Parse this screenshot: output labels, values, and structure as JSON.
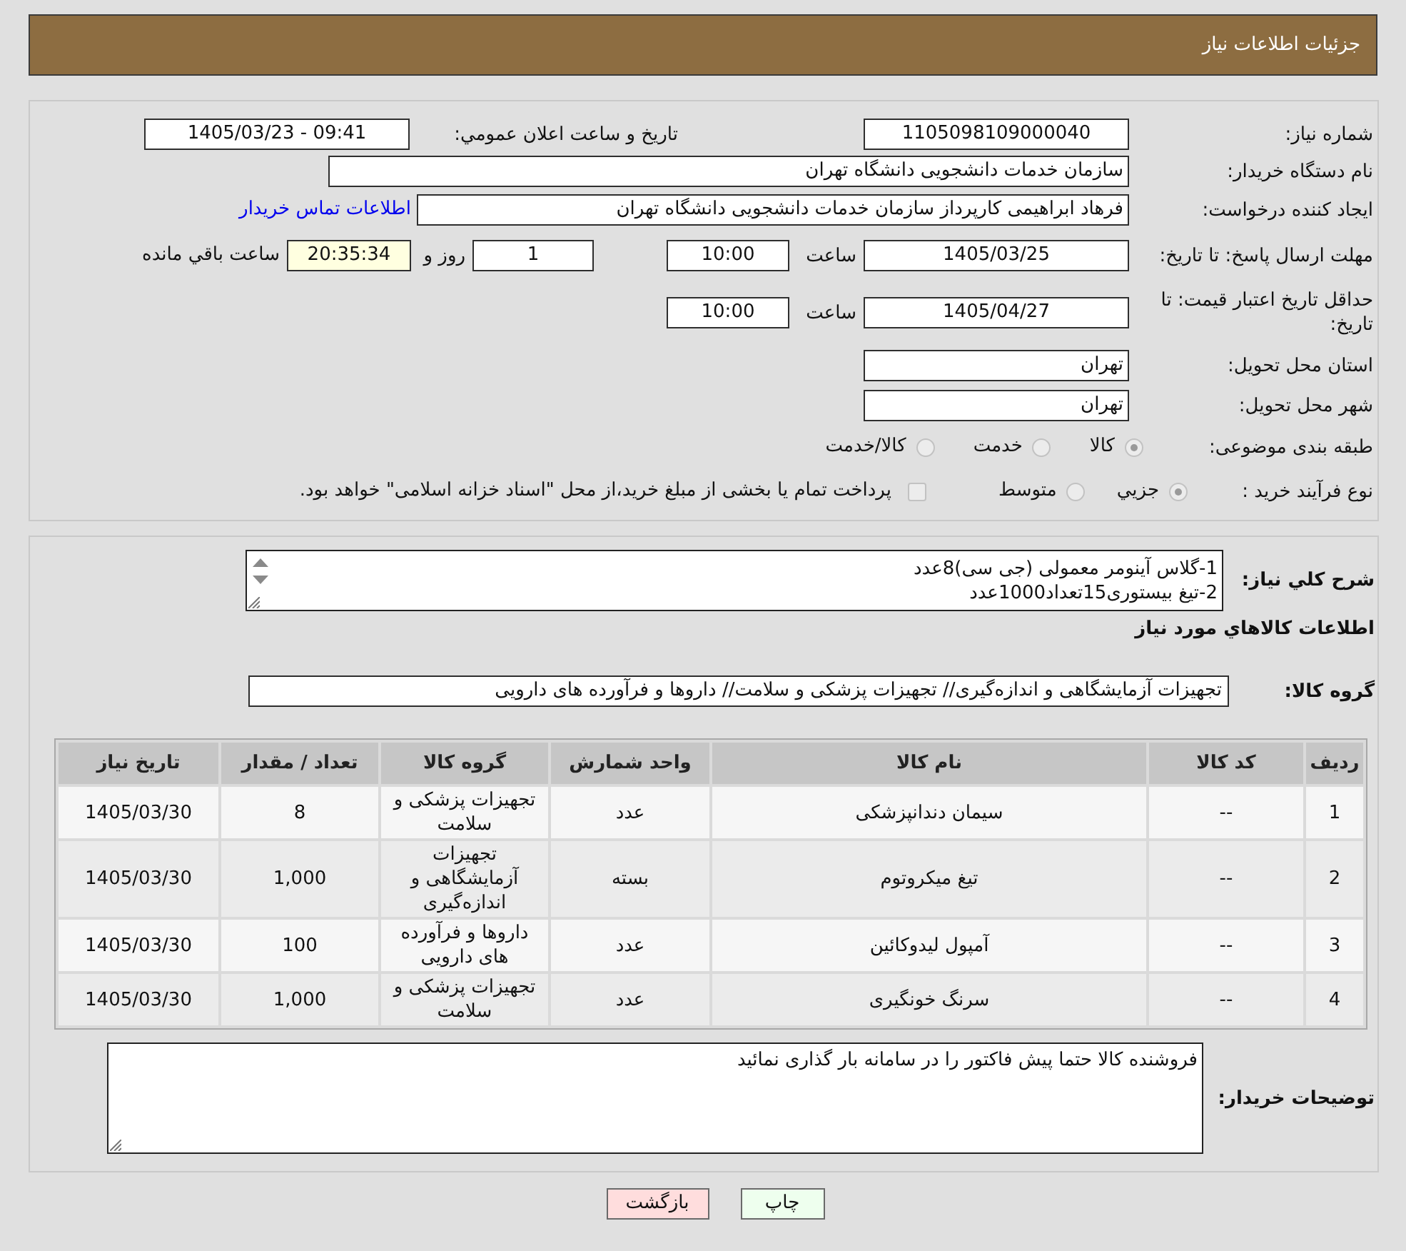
{
  "header": {
    "title": "جزئیات اطلاعات نیاز"
  },
  "details": {
    "need_number": {
      "label": "شماره نیاز:",
      "value": "1105098109000040"
    },
    "announce_datetime": {
      "label": "تاریخ و ساعت اعلان عمومي:",
      "value": "1405/03/23 - 09:41"
    },
    "buyer_org": {
      "label": "نام دستگاه خریدار:",
      "value": "سازمان خدمات دانشجویی دانشگاه تهران"
    },
    "requester": {
      "label": "ایجاد کننده درخواست:",
      "value": "فرهاد ابراهیمی کارپرداز سازمان خدمات دانشجویی دانشگاه تهران",
      "link": "اطلاعات تماس خریدار"
    },
    "reply_deadline": {
      "label": "مهلت ارسال پاسخ: تا تاریخ:",
      "date": "1405/03/25",
      "time_label": "ساعت",
      "time": "10:00",
      "days": "1",
      "days_label": "روز و",
      "remaining": "20:35:34",
      "remaining_label": "ساعت باقي مانده"
    },
    "price_validity": {
      "label": "حداقل تاریخ اعتبار قیمت: تا تاریخ:",
      "date": "1405/04/27",
      "time_label": "ساعت",
      "time": "10:00"
    },
    "province": {
      "label": "استان محل تحویل:",
      "value": "تهران"
    },
    "city": {
      "label": "شهر محل تحویل:",
      "value": "تهران"
    },
    "category": {
      "label": "طبقه بندی موضوعی:",
      "disabled": true,
      "options": [
        {
          "label": "کالا",
          "selected": true
        },
        {
          "label": "خدمت",
          "selected": false
        },
        {
          "label": "کالا/خدمت",
          "selected": false
        }
      ]
    },
    "purchase_process": {
      "label": "نوع فرآیند خرید :",
      "disabled": true,
      "options": [
        {
          "label": "جزیي",
          "selected": true
        },
        {
          "label": "متوسط",
          "selected": false
        }
      ],
      "treasury_payment": {
        "label": "پرداخت تمام یا بخشی از مبلغ خرید،از محل \"اسناد خزانه اسلامی\" خواهد بود.",
        "checked": false
      }
    }
  },
  "needs": {
    "description": {
      "label": "شرح کلي نیاز:",
      "value": "1-گلاس آینومر معمولی (جی سی)8عدد\n2-تیغ بیستوری15تعداد1000عدد"
    },
    "items_heading": "اطلاعات کالاهاي مورد نیاز",
    "goods_group": {
      "label": "گروه کالا:",
      "value": "تجهیزات آزمایشگاهی و اندازه‌گیری// تجهیزات پزشکی و سلامت// داروها و فرآورده های دارویی"
    },
    "table": {
      "columns": [
        "ردیف",
        "کد کالا",
        "نام کالا",
        "واحد شمارش",
        "گروه کالا",
        "تعداد / مقدار",
        "تاریخ نیاز"
      ],
      "rows": [
        [
          "1",
          "--",
          "سیمان دندانپزشکی",
          "عدد",
          "تجهیزات پزشکی و سلامت",
          "8",
          "1405/03/30"
        ],
        [
          "2",
          "--",
          "تیغ میکروتوم",
          "بسته",
          "تجهیزات آزمایشگاهی و اندازه‌گیری",
          "1,000",
          "1405/03/30"
        ],
        [
          "3",
          "--",
          "آمپول لیدوکائین",
          "عدد",
          "داروها و فرآورده های دارویی",
          "100",
          "1405/03/30"
        ],
        [
          "4",
          "--",
          "سرنگ خونگیری",
          "عدد",
          "تجهیزات پزشکی و سلامت",
          "1,000",
          "1405/03/30"
        ]
      ]
    },
    "buyer_notes": {
      "label": "توضیحات خریدار:",
      "value": "فروشنده کالا حتما پیش فاکتور را در سامانه بار گذاری نمائید"
    }
  },
  "buttons": [
    {
      "kind": "print",
      "label": "چاپ"
    },
    {
      "kind": "back",
      "label": "بازگشت"
    }
  ]
}
